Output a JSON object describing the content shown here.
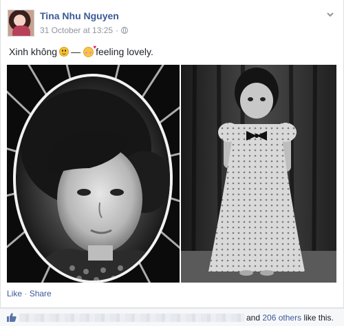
{
  "post": {
    "author": "Tina Nhu Nguyen",
    "timestamp": "31 October at 13:25",
    "separator": "·",
    "privacy_icon": "globe-icon",
    "menu_icon": "chevron-down-icon",
    "status_text": "Xinh không",
    "status_emoji": "smile-emoji",
    "dash": "—",
    "feeling_emoji": "smiling-hearts-emoji",
    "feeling_text": "feeling lovely."
  },
  "photos": [
    {
      "description_icon": "vintage-portrait-photo"
    },
    {
      "description_icon": "vintage-child-in-dress-photo"
    }
  ],
  "actions": {
    "like_label": "Like",
    "separator": "·",
    "share_label": "Share"
  },
  "likes": {
    "icon": "thumbs-up-icon",
    "prefix": "and",
    "others_count": "206",
    "others_label": "others",
    "suffix": "like this."
  },
  "colors": {
    "link": "#3b5998",
    "meta": "#90949c",
    "text": "#141823",
    "like_bar_bg": "#f6f7f9"
  }
}
